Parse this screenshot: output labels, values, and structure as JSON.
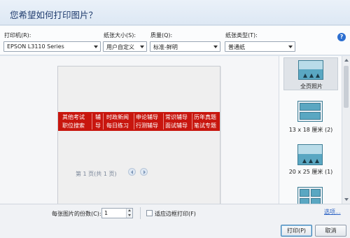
{
  "dialog": {
    "title": "您希望如何打印图片？",
    "help_glyph": "?"
  },
  "options": {
    "printer": {
      "label": "打印机(R):",
      "value": "EPSON L3110 Series"
    },
    "paper_size": {
      "label": "纸张大小(S):",
      "value": "用户自定义"
    },
    "quality": {
      "label": "质量(Q):",
      "value": "标准-鲜明"
    },
    "paper_type": {
      "label": "纸张类型(T):",
      "value": "普通纸"
    }
  },
  "preview": {
    "banner": [
      [
        "其他考试",
        "职位搜索"
      ],
      [
        "辅",
        "导"
      ],
      [
        "时政新闻",
        "每日练习"
      ],
      [
        "申论辅导",
        "行测辅导"
      ],
      [
        "常识辅导",
        "面试辅导"
      ],
      [
        "历年真题",
        "笔试专题"
      ]
    ],
    "page_info": "第 1 页(共 1 页)"
  },
  "layouts": [
    {
      "label": "全页照片",
      "selected": true
    },
    {
      "label": "13 x 18 厘米 (2)",
      "selected": false
    },
    {
      "label": "20 x 25 厘米 (1)",
      "selected": false
    },
    {
      "label": "",
      "selected": false
    }
  ],
  "bottom": {
    "copies_label": "每张图片的份数(C):",
    "copies_value": "1",
    "fit_label": "适应边框打印(F)",
    "options_link": "选项...",
    "print_button": "打印(P)",
    "cancel_button": "取消"
  },
  "colors": {
    "banner": "#c8160e",
    "accent": "#2d6fd0"
  }
}
